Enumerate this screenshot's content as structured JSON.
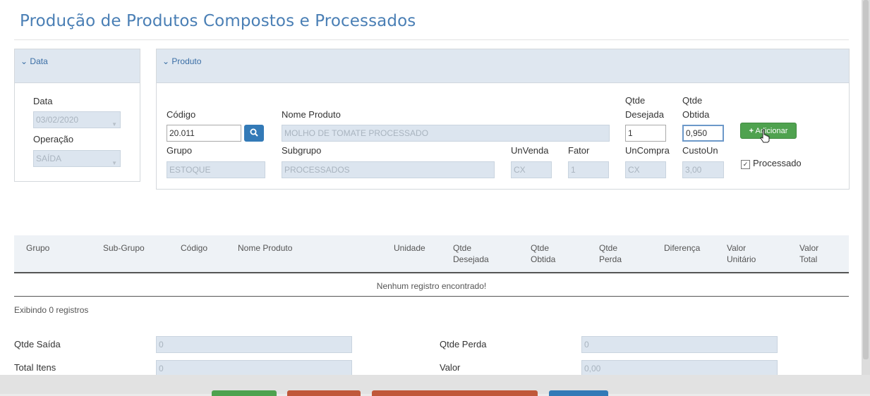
{
  "page": {
    "title": "Produção de Produtos Compostos e Processados"
  },
  "data_panel": {
    "header": "Data",
    "date_label": "Data",
    "date_value": "03/02/2020",
    "operation_label": "Operação",
    "operation_value": "SAÍDA"
  },
  "product_panel": {
    "header": "Produto",
    "codigo_label": "Código",
    "codigo_value": "20.011",
    "nome_label": "Nome Produto",
    "nome_value": "MOLHO DE TOMATE PROCESSADO",
    "qtde_desejada_label_1": "Qtde",
    "qtde_desejada_label_2": "Desejada",
    "qtde_desejada_value": "1",
    "qtde_obtida_label_1": "Qtde",
    "qtde_obtida_label_2": "Obtida",
    "qtde_obtida_value": "0,950",
    "add_button": "Adicionar",
    "grupo_label": "Grupo",
    "grupo_value": "ESTOQUE",
    "subgrupo_label": "Subgrupo",
    "subgrupo_value": "PROCESSADOS",
    "unvenda_label": "UnVenda",
    "unvenda_value": "CX",
    "fator_label": "Fator",
    "fator_value": "1",
    "uncompra_label": "UnCompra",
    "uncompra_value": "CX",
    "custoun_label": "CustoUn",
    "custoun_value": "3,00",
    "processado_label": "Processado",
    "processado_checked": true
  },
  "grid": {
    "columns": [
      {
        "l1": "",
        "l2": "Grupo"
      },
      {
        "l1": "",
        "l2": "Sub-Grupo"
      },
      {
        "l1": "",
        "l2": "Código"
      },
      {
        "l1": "",
        "l2": "Nome Produto"
      },
      {
        "l1": "",
        "l2": "Unidade"
      },
      {
        "l1": "Qtde",
        "l2": "Desejada"
      },
      {
        "l1": "Qtde",
        "l2": "Obtida"
      },
      {
        "l1": "Qtde",
        "l2": "Perda"
      },
      {
        "l1": "",
        "l2": "Diferença"
      },
      {
        "l1": "Valor",
        "l2": "Unitário"
      },
      {
        "l1": "Valor",
        "l2": "Total"
      }
    ],
    "empty_message": "Nenhum registro encontrado!",
    "record_count": "Exibindo 0 registros"
  },
  "summary": {
    "qtde_saida_label": "Qtde Saída",
    "qtde_saida_value": "0",
    "total_itens_label": "Total Itens",
    "total_itens_value": "0",
    "qtde_perda_label": "Qtde Perda",
    "qtde_perda_value": "0",
    "valor_label": "Valor",
    "valor_value": "0,00"
  },
  "colors": {
    "accent": "#4a7fb5",
    "success": "#4fa24f",
    "primary": "#337ab7",
    "danger": "#c0583a"
  }
}
